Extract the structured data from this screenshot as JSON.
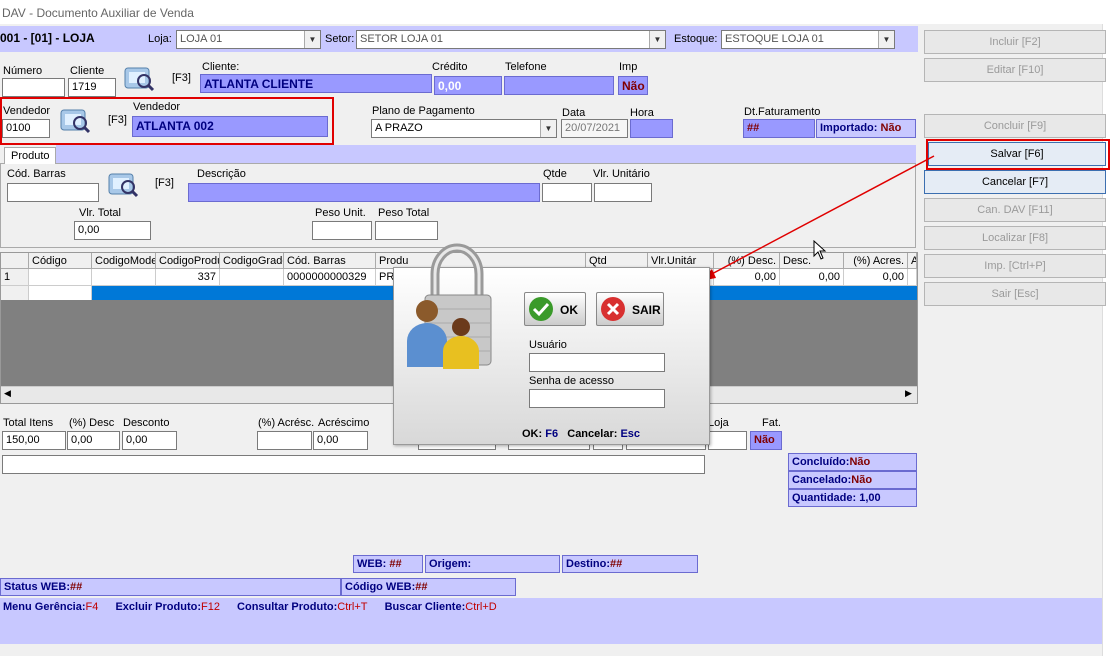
{
  "window": {
    "title": "DAV - Documento Auxiliar de Venda"
  },
  "header": {
    "store_label": "001 - [01] - LOJA",
    "loja_label": "Loja:",
    "loja_value": "LOJA 01",
    "setor_label": "Setor:",
    "setor_value": "SETOR LOJA 01",
    "estoque_label": "Estoque:",
    "estoque_value": "ESTOQUE LOJA 01"
  },
  "form": {
    "numero_label": "Número",
    "numero_value": "",
    "cliente_code_label": "Cliente",
    "cliente_code_value": "1719",
    "f3": "[F3]",
    "cliente_label": "Cliente:",
    "cliente_value": "ATLANTA CLIENTE",
    "credito_label": "Crédito",
    "credito_value": "0,00",
    "telefone_label": "Telefone",
    "telefone_value": "",
    "imp_label": "Imp",
    "imp_value": "Não",
    "vendedor_code_label": "Vendedor",
    "vendedor_code_value": "0100",
    "vendedor_label": "Vendedor",
    "vendedor_value": "ATLANTA 002",
    "plano_label": "Plano de Pagamento",
    "plano_value": "A PRAZO",
    "data_label": "Data",
    "data_value": "20/07/2021",
    "hora_label": "Hora",
    "hora_value": "",
    "dtfat_label": "Dt.Faturamento",
    "dtfat_value": "##",
    "importado_label": "Importado:",
    "importado_value": "Não"
  },
  "product": {
    "tab": "Produto",
    "codbarras_label": "Cód. Barras",
    "descricao_label": "Descrição",
    "qtde_label": "Qtde",
    "vlr_unit_label": "Vlr. Unitário",
    "vlr_total_label": "Vlr. Total",
    "vlr_total_value": "0,00",
    "peso_unit_label": "Peso Unit.",
    "peso_total_label": "Peso Total"
  },
  "grid": {
    "columns": [
      "Código",
      "CodigoModel",
      "CodigoProdu",
      "CodigoGrade",
      "Cód. Barras",
      "Produ",
      "Qtd",
      "Vlr.Unitár",
      "(%) Desc.",
      "Desc.",
      "(%) Acres.",
      "A"
    ],
    "row": {
      "index": "1",
      "codigo": "",
      "codigo_model": "",
      "codigo_produ": "337",
      "codigo_grade": "",
      "cod_barras": "0000000000329",
      "produto": "PR",
      "pct_desc": "0,00",
      "desc": "0,00",
      "pct_acres": "0,00"
    }
  },
  "totals": {
    "total_itens_label": "Total Itens",
    "total_itens_value": "150,00",
    "pct_desc_label": "(%) Desc",
    "pct_desc_value": "0,00",
    "desconto_label": "Desconto",
    "desconto_value": "0,00",
    "pct_acresc_label": "(%) Acrésc.",
    "pct_acresc_value": "",
    "acrescimo_label": "Acréscimo",
    "acrescimo_value": "0,00",
    "loja_label": "Loja",
    "fat_label": "Fat.",
    "fat_value": "Não"
  },
  "status_box": {
    "concluido_label": "Concluído:",
    "concluido_value": "Não",
    "cancelado_label": "Cancelado:",
    "cancelado_value": "Não",
    "quantidade_label": "Quantidade:",
    "quantidade_value": "1,00"
  },
  "web_bar": {
    "web_label": "WEB:",
    "web_value": "##",
    "origem_label": "Origem:",
    "destino_label": "Destino:",
    "destino_value": "##",
    "status_web_label": "Status WEB:",
    "status_web_value": "##",
    "codigo_web_label": "Código WEB:",
    "codigo_web_value": "##"
  },
  "footer": {
    "menu_label": "Menu Gerência:",
    "menu_key": "F4",
    "excluir_label": "Excluir Produto:",
    "excluir_key": "F12",
    "consultar_label": "Consultar Produto:",
    "consultar_key": "Ctrl+T",
    "buscar_label": "Buscar Cliente:",
    "buscar_key": "Ctrl+D"
  },
  "buttons": {
    "incluir": "Incluir [F2]",
    "editar": "Editar [F10]",
    "concluir": "Concluir [F9]",
    "salvar": "Salvar [F6]",
    "cancelar": "Cancelar [F7]",
    "can_dav": "Can. DAV [F11]",
    "localizar": "Localizar [F8]",
    "imp": "Imp. [Ctrl+P]",
    "sair": "Sair [Esc]"
  },
  "login_dialog": {
    "ok_label": "OK",
    "sair_label": "SAIR",
    "usuario_label": "Usuário",
    "usuario_value": "",
    "senha_label": "Senha de acesso",
    "senha_value": "",
    "hint_ok_label": "OK:",
    "hint_ok_key": "F6",
    "hint_cancel_label": "Cancelar:",
    "hint_cancel_key": "Esc"
  },
  "colors": {
    "accent_blue": "#9999ff",
    "dark_red": "#800000",
    "navy": "#000080",
    "highlight_red": "#e00000"
  }
}
